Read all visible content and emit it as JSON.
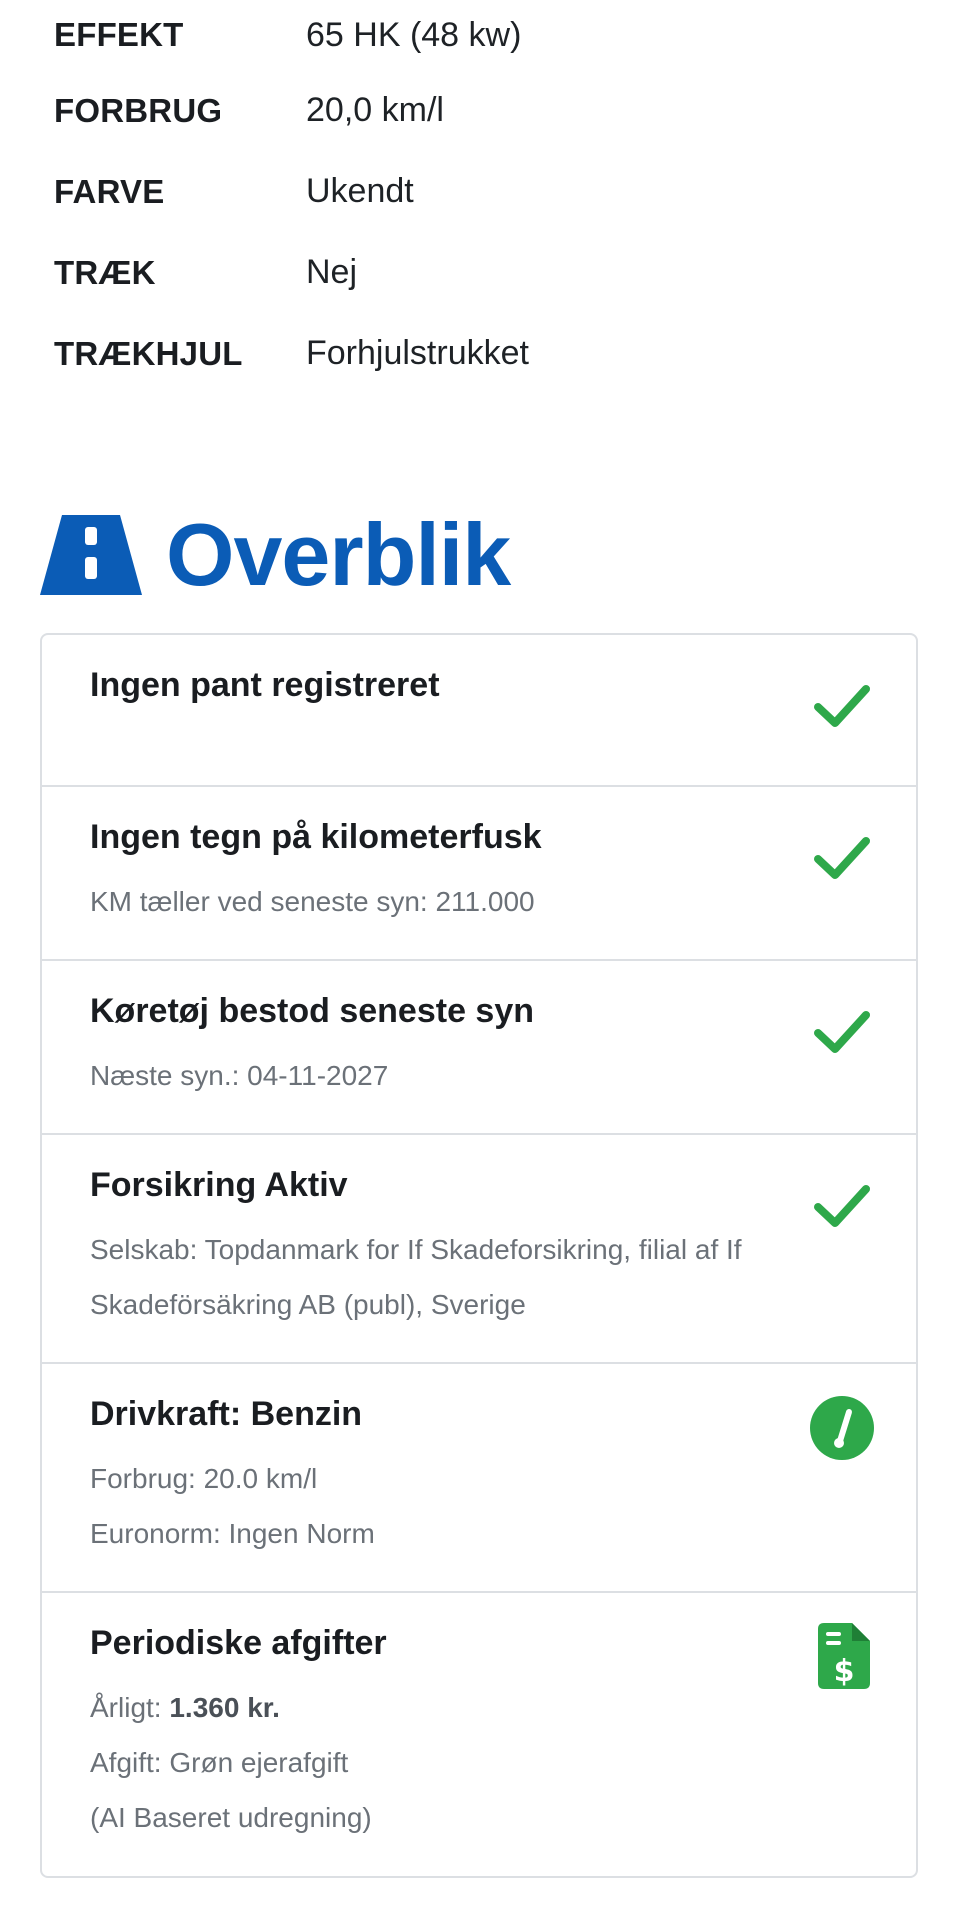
{
  "specs": [
    {
      "label": "EFFEKT",
      "value": "65 HK (48 kw)"
    },
    {
      "label": "FORBRUG",
      "value": "20,0 km/l"
    },
    {
      "label": "FARVE",
      "value": "Ukendt"
    },
    {
      "label": "TRÆK",
      "value": "Nej"
    },
    {
      "label": "TRÆKHJUL",
      "value": "Forhjulstrukket"
    }
  ],
  "overview": {
    "title": "Overblik",
    "icon": "road-icon",
    "accent_color": "#0b5cb6",
    "success_color": "#2ea84a"
  },
  "items": [
    {
      "title": "Ingen pant registreret",
      "icon": "check-icon",
      "lines": []
    },
    {
      "title": "Ingen tegn på kilometerfusk",
      "icon": "check-icon",
      "lines": [
        "KM tæller ved seneste syn: 211.000"
      ]
    },
    {
      "title": "Køretøj bestod seneste syn",
      "icon": "check-icon",
      "lines": [
        "Næste syn.: 04-11-2027"
      ]
    },
    {
      "title": "Forsikring Aktiv",
      "icon": "check-icon",
      "lines": [
        "Selskab: Topdanmark for If Skadeforsikring, filial af If",
        "Skadeförsäkring AB (publ), Sverige"
      ]
    },
    {
      "title": "Drivkraft: Benzin",
      "icon": "gauge-icon",
      "lines": [
        "Forbrug: 20.0 km/l",
        "Euronorm: Ingen Norm"
      ]
    },
    {
      "title": "Periodiske afgifter",
      "icon": "invoice-dollar-icon",
      "annual_label": "Årligt:",
      "annual_amount": "1.360 kr.",
      "lines": [
        "Afgift: Grøn ejerafgift",
        "(AI Baseret udregning)"
      ]
    }
  ]
}
